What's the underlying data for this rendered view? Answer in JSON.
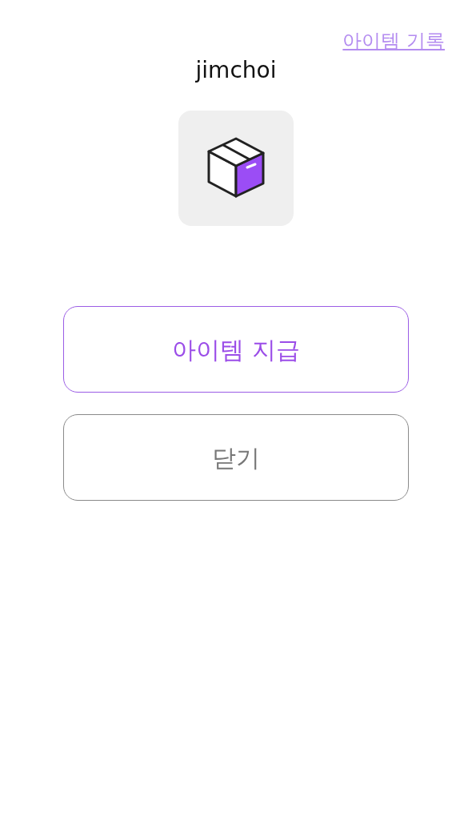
{
  "history_link": "아이템 기록",
  "username": "jimchoi",
  "buttons": [
    {
      "label": "아이템 지급",
      "kind": "primary"
    },
    {
      "label": "닫기",
      "kind": "secondary"
    }
  ]
}
